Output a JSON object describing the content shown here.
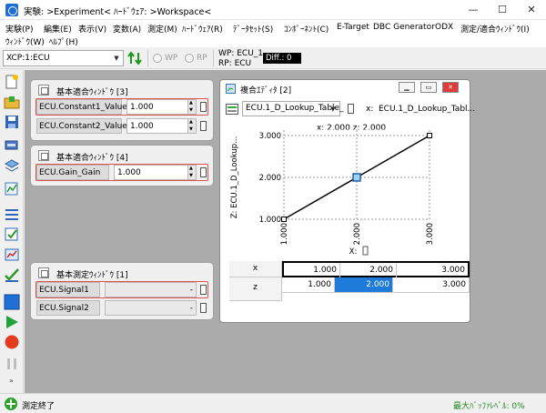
{
  "window": {
    "title": "実験: >Experiment< ﾊｰﾄﾞｳｪｱ: >Workspace<",
    "min_glyph": "—",
    "max_glyph": "☐",
    "close_glyph": "✕"
  },
  "menu": {
    "row1": [
      "実験(P)",
      "編集(E)",
      "表示(V)",
      "変数(A)",
      "測定(M)",
      "ﾊｰﾄﾞｳｪｱ(R)",
      "ﾃﾞｰﾀｾｯﾄ(S)",
      "ｺﾝﾎﾟｰﾈﾝﾄ(C)",
      "E-Target",
      "DBC Generator",
      "ODX",
      "測定/適合ｳｨﾝﾄﾞｳ(I)"
    ],
    "row2": [
      "ｳｨﾝﾄﾞｳ(W)",
      "ﾍﾙﾌﾟ(H)"
    ]
  },
  "toolbar": {
    "device_select": "XCP:1:ECU",
    "wp_label": "WP",
    "rp_label": "RP",
    "wp_info": "WP: ECU_1",
    "rp_info": "RP: ECU",
    "diff_label": "Diff.: 0"
  },
  "windows": {
    "calib3": {
      "title": "基本適合ｳｨﾝﾄﾞｳ [3]",
      "rows": [
        {
          "name": "ECU.Constant1_Value",
          "value": "1.000"
        },
        {
          "name": "ECU.Constant2_Value",
          "value": "1.000"
        }
      ]
    },
    "calib4": {
      "title": "基本適合ｳｨﾝﾄﾞｳ [4]",
      "rows": [
        {
          "name": "ECU.Gain_Gain",
          "value": "1.000"
        }
      ]
    },
    "measure1": {
      "title": "基本測定ｳｨﾝﾄﾞｳ [1]",
      "rows": [
        {
          "name": "ECU.Signal1",
          "value": "-"
        },
        {
          "name": "ECU.Signal2",
          "value": "-"
        }
      ]
    },
    "combined": {
      "title": "複合ｴﾃﾞｨﾀ [2]",
      "map_select": "ECU.1_D_Lookup_Table_",
      "axis_label_header": "x:",
      "map_name_header": "ECU.1_D_Lookup_Tabl...",
      "plot_title": "x: 2.000 z: 2.000",
      "table": {
        "row_headers": [
          "x",
          "z"
        ],
        "x": [
          "1.000",
          "2.000",
          "3.000"
        ],
        "z": [
          "1.000",
          "2.000",
          "3.000"
        ]
      }
    }
  },
  "chart_data": {
    "type": "line",
    "x": [
      1.0,
      2.0,
      3.0
    ],
    "series": [
      {
        "values": [
          1.0,
          2.0,
          3.0
        ]
      }
    ],
    "xlabel": "X:",
    "ylabel": "Z: ECU.1_D_Lookup...",
    "xticks": [
      "1.000",
      "2.000",
      "3.000"
    ],
    "yticks": [
      "1.000",
      "2.000",
      "3.000"
    ],
    "xlim": [
      1.0,
      3.0
    ],
    "ylim": [
      1.0,
      3.0
    ],
    "selected_index": 1
  },
  "status": {
    "message": "測定終了",
    "buffer": "最大ﾊﾞｯﾌｧﾚﾍﾞﾙ: 0%"
  },
  "colors": {
    "highlight_border": "#d9534f",
    "selection": "#1e7bd9",
    "workspace": "#ababab"
  }
}
